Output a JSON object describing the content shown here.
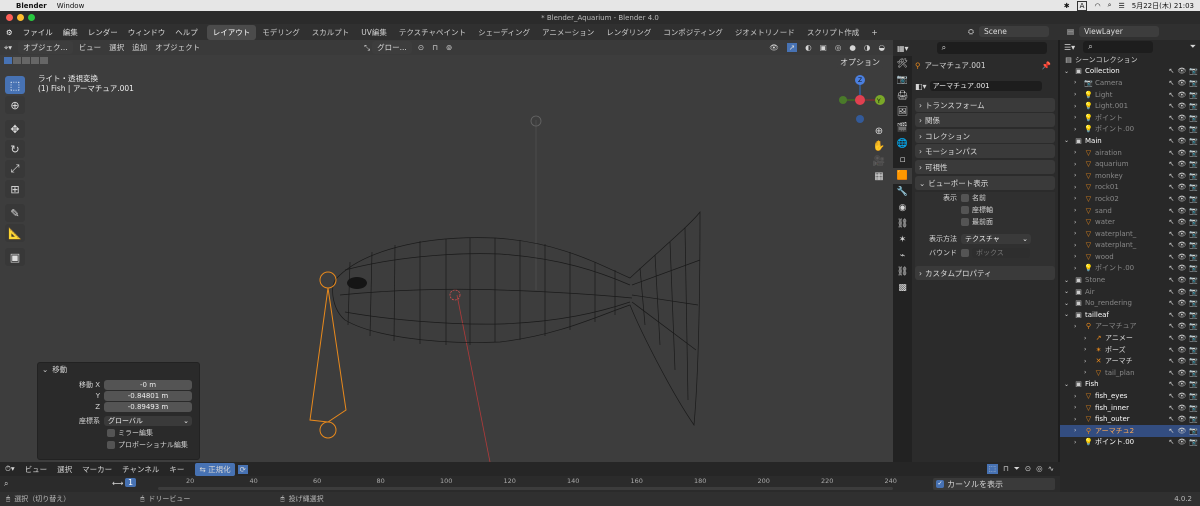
{
  "mac": {
    "apple": "",
    "app": "Blender",
    "menu": "Window",
    "clock": "5月22日(木) 21:03",
    "a_label": "A"
  },
  "window_title": "* Blender_Aquarium - Blender 4.0",
  "topmenu": {
    "items": [
      "ファイル",
      "編集",
      "レンダー",
      "ウィンドウ",
      "ヘルプ"
    ]
  },
  "workspaces": [
    "レイアウト",
    "モデリング",
    "スカルプト",
    "UV編集",
    "テクスチャペイント",
    "シェーディング",
    "アニメーション",
    "レンダリング",
    "コンポジティング",
    "ジオメトリノード",
    "スクリプト作成"
  ],
  "scene": "Scene",
  "viewlayer": "ViewLayer",
  "viewport": {
    "mode": "オブジェク...",
    "menus": [
      "ビュー",
      "選択",
      "追加",
      "オブジェクト"
    ],
    "orientation": "グロー...",
    "options": "オプション",
    "info_line1": "ライト・透視変換",
    "info_line2": "(1) Fish | アーマチュア.001",
    "axis": {
      "x": "X",
      "y": "Y",
      "z": "Z"
    }
  },
  "operator": {
    "title": "移動",
    "x_label": "移動 X",
    "x_value": "-0 m",
    "y_label": "Y",
    "y_value": "-0.84801 m",
    "z_label": "Z",
    "z_value": "-0.89493 m",
    "coord_label": "座標系",
    "coord_value": "グローバル",
    "mirror": "ミラー編集",
    "proportional": "プロポーショナル編集"
  },
  "properties": {
    "object_name": "アーマチュア.001",
    "name_field": "アーマチュア.001",
    "panels": [
      "トランスフォーム",
      "関係",
      "コレクション",
      "モーションパス",
      "可視性"
    ],
    "viewport_display": "ビューポート表示",
    "show_label": "表示",
    "show_items": [
      "名前",
      "座標軸",
      "最前面"
    ],
    "display_as_label": "表示方法",
    "display_as_value": "テクスチャ",
    "bounds_label": "バウンド",
    "bounds_value": "ボックス",
    "custom_props": "カスタムプロパティ"
  },
  "outliner": {
    "root": "シーンコレクション",
    "rows": [
      {
        "name": "Collection",
        "depth": 0,
        "icon": "collection-icon",
        "color": "#ffffff"
      },
      {
        "name": "Camera",
        "depth": 1,
        "icon": "camera-icon",
        "color": "#888888"
      },
      {
        "name": "Light",
        "depth": 1,
        "icon": "light-icon",
        "color": "#888888"
      },
      {
        "name": "Light.001",
        "depth": 1,
        "icon": "light-icon",
        "color": "#888888"
      },
      {
        "name": "ポイント",
        "depth": 1,
        "icon": "light-icon",
        "color": "#888888"
      },
      {
        "name": "ポイント.00",
        "depth": 1,
        "icon": "light-icon",
        "color": "#888888"
      },
      {
        "name": "Main",
        "depth": 0,
        "icon": "collection-icon",
        "color": "#ffffff"
      },
      {
        "name": "airation",
        "depth": 1,
        "icon": "mesh-icon",
        "color": "#888888"
      },
      {
        "name": "aquarium",
        "depth": 1,
        "icon": "mesh-icon",
        "color": "#888888"
      },
      {
        "name": "monkey",
        "depth": 1,
        "icon": "mesh-icon",
        "color": "#888888"
      },
      {
        "name": "rock01",
        "depth": 1,
        "icon": "mesh-icon",
        "color": "#888888"
      },
      {
        "name": "rock02",
        "depth": 1,
        "icon": "mesh-icon",
        "color": "#888888"
      },
      {
        "name": "sand",
        "depth": 1,
        "icon": "mesh-icon",
        "color": "#888888"
      },
      {
        "name": "water",
        "depth": 1,
        "icon": "mesh-icon",
        "color": "#888888"
      },
      {
        "name": "waterplant_",
        "depth": 1,
        "icon": "mesh-icon",
        "color": "#888888"
      },
      {
        "name": "waterplant_",
        "depth": 1,
        "icon": "mesh-icon",
        "color": "#888888"
      },
      {
        "name": "wood",
        "depth": 1,
        "icon": "mesh-icon",
        "color": "#888888"
      },
      {
        "name": "ポイント.00",
        "depth": 1,
        "icon": "light-icon",
        "color": "#888888"
      },
      {
        "name": "Stone",
        "depth": 0,
        "icon": "collection-icon",
        "color": "#888888"
      },
      {
        "name": "Air",
        "depth": 0,
        "icon": "collection-icon",
        "color": "#888888"
      },
      {
        "name": "No_rendering",
        "depth": 0,
        "icon": "collection-icon",
        "color": "#888888"
      },
      {
        "name": "tailleaf",
        "depth": 0,
        "icon": "collection-icon",
        "color": "#ffffff"
      },
      {
        "name": "アーマチュア",
        "depth": 1,
        "icon": "armature-icon",
        "color": "#888888"
      },
      {
        "name": "アニメー",
        "depth": 2,
        "icon": "action-icon",
        "color": "#dddddd"
      },
      {
        "name": "ポーズ",
        "depth": 2,
        "icon": "pose-icon",
        "color": "#dddddd"
      },
      {
        "name": "アーマチ",
        "depth": 2,
        "icon": "armature-data-icon",
        "color": "#dddddd"
      },
      {
        "name": "tail_plan",
        "depth": 2,
        "icon": "mesh-icon",
        "color": "#888888"
      },
      {
        "name": "Fish",
        "depth": 0,
        "icon": "collection-icon",
        "color": "#ffffff"
      },
      {
        "name": "fish_eyes",
        "depth": 1,
        "icon": "mesh-icon",
        "color": "#ffffff"
      },
      {
        "name": "fish_inner",
        "depth": 1,
        "icon": "mesh-icon",
        "color": "#ffffff"
      },
      {
        "name": "fish_outer",
        "depth": 1,
        "icon": "mesh-icon",
        "color": "#ffffff"
      },
      {
        "name": "アーマチュ2",
        "depth": 1,
        "icon": "armature-icon",
        "color": "#ffaa55",
        "selected": true
      },
      {
        "name": "ポイント.00",
        "depth": 1,
        "icon": "light-icon",
        "color": "#ffffff"
      }
    ]
  },
  "timeline": {
    "menus": [
      "ビュー",
      "選択",
      "マーカー",
      "チャンネル",
      "キー"
    ],
    "normalize": "正規化",
    "current_frame": "1",
    "ticks": [
      "20",
      "40",
      "60",
      "80",
      "100",
      "120",
      "140",
      "160",
      "180",
      "200",
      "220",
      "240"
    ],
    "cursor_show": "カーソルを表示"
  },
  "status": {
    "select": "選択（切り替え）",
    "dolly": "ドリービュー",
    "lasso": "投げ縄選択",
    "version": "4.0.2"
  },
  "colors": {
    "accent": "#4772b3",
    "armature": "#e8891c",
    "selected_row": "#334d80"
  }
}
